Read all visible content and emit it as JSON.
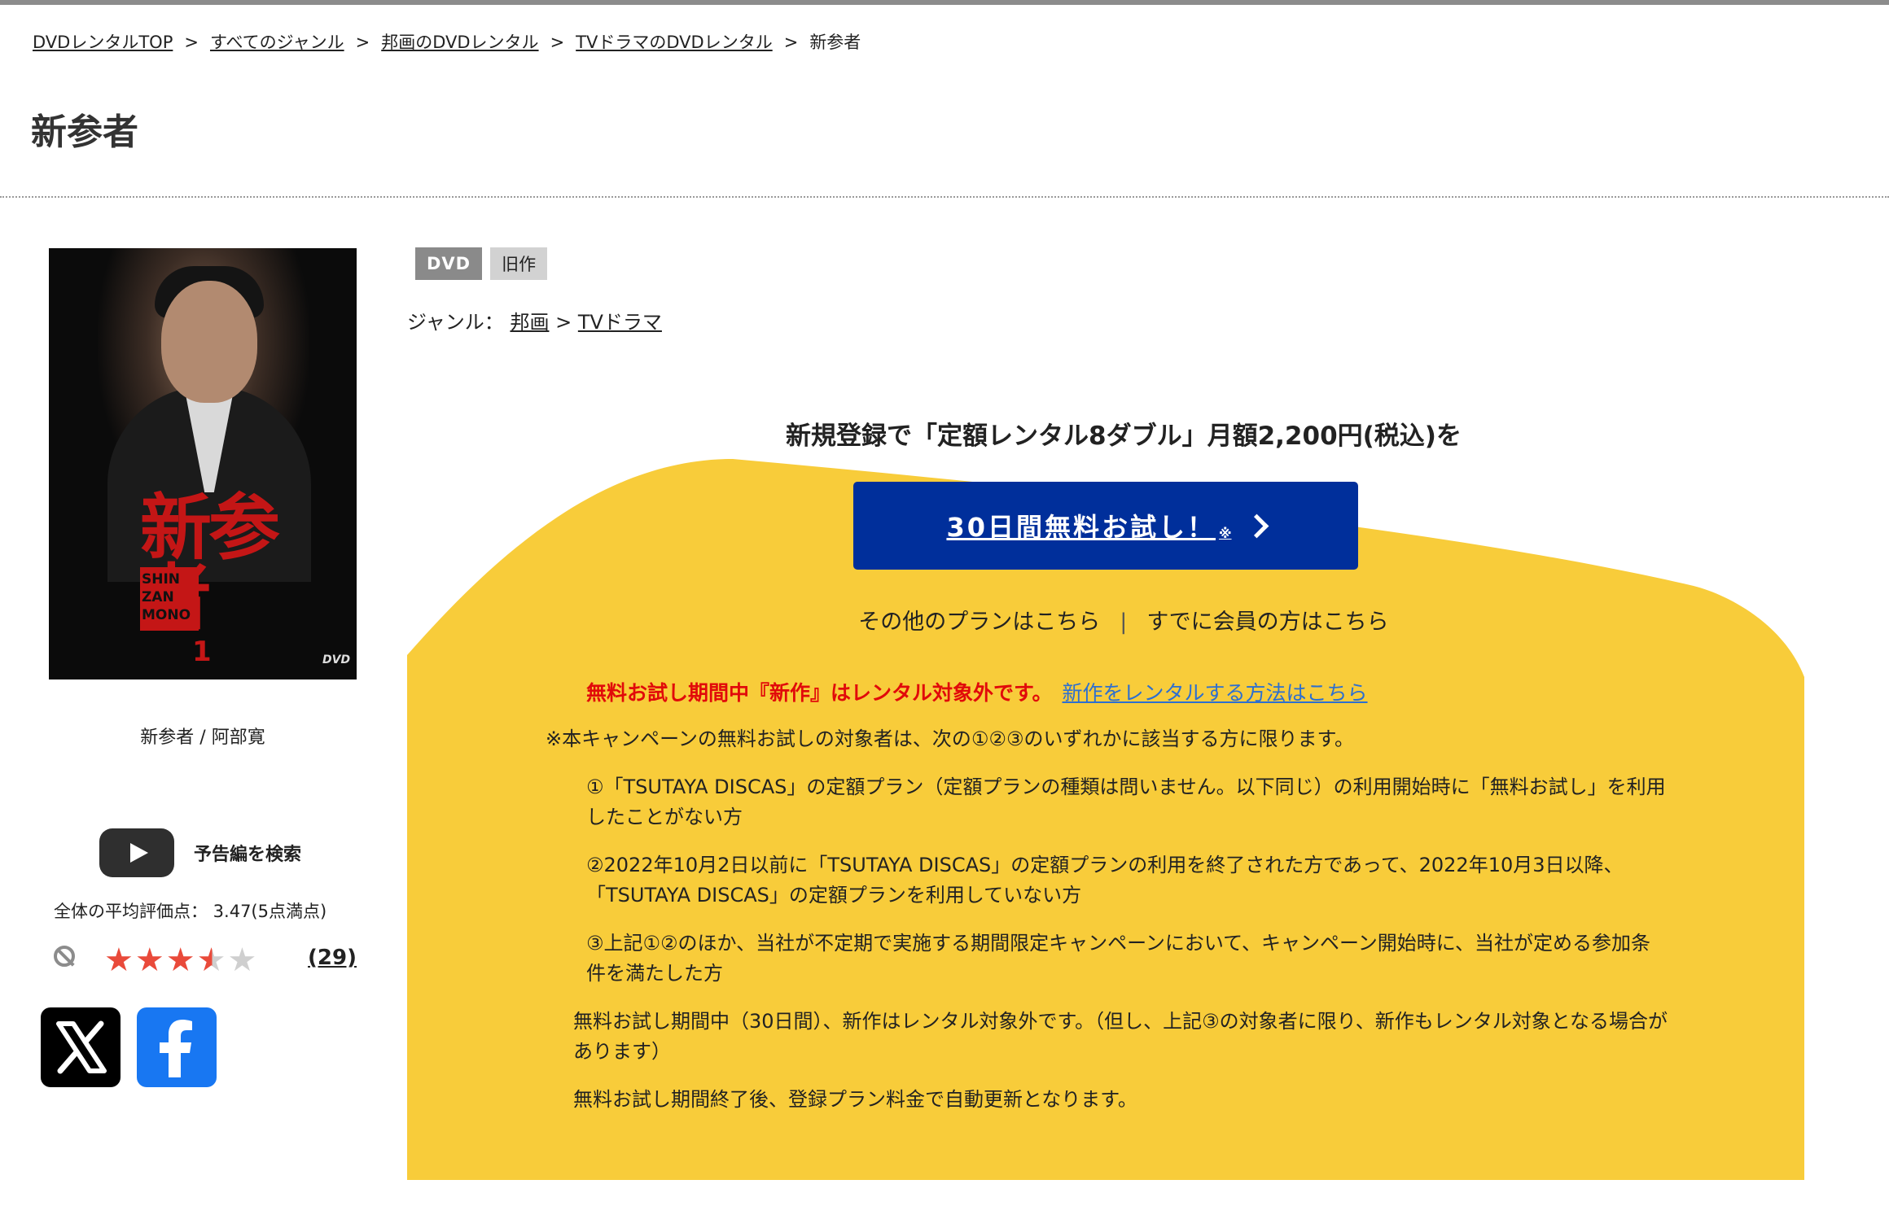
{
  "breadcrumb": {
    "items": [
      "DVDレンタルTOP",
      "すべてのジャンル",
      "邦画のDVDレンタル",
      "TVドラマのDVDレンタル"
    ],
    "current": "新参者",
    "separator": ">"
  },
  "page": {
    "title": "新参者"
  },
  "cover": {
    "title": "新参者",
    "subtitle_lines": [
      "SHIN",
      "ZAN",
      "MONO"
    ],
    "volume": "1",
    "dvd_mark": "DVD"
  },
  "item": {
    "caption": "新参者 / 阿部寛"
  },
  "trailer": {
    "label": "予告編を検索"
  },
  "rating": {
    "average_text": "全体の平均評価点： 3.47(5点満点)",
    "value": 3.47,
    "max": 5,
    "count": "(29)"
  },
  "tags": {
    "format": "DVD",
    "status": "旧作"
  },
  "genre": {
    "label": "ジャンル：",
    "parent": "邦画",
    "separator": ">",
    "child": "TVドラマ"
  },
  "promo": {
    "headline": "新規登録で「定額レンタル8ダブル」月額2,200円(税込)を",
    "cta_label": "30日間無料お試し！",
    "cta_note": "※",
    "other_plans": "その他のプランはこちら",
    "divider": "|",
    "members": "すでに会員の方はこちら",
    "warning": "無料お試し期間中『新作』はレンタル対象外です。",
    "warning_link": "新作をレンタルする方法はこちら",
    "bg_color": "#f8cc3a",
    "cta_color": "#002f9b"
  },
  "notes": {
    "intro": "※本キャンペーンの無料お試しの対象者は、次の①②③のいずれかに該当する方に限ります。",
    "item1": "①「TSUTAYA DISCAS」の定額プラン（定額プランの種類は問いません。以下同じ）の利用開始時に「無料お試し」を利用したことがない方",
    "item2": "②2022年10月2日以前に「TSUTAYA DISCAS」の定額プランの利用を終了された方であって、2022年10月3日以降、「TSUTAYA DISCAS」の定額プランを利用していない方",
    "item3": "③上記①②のほか、当社が不定期で実施する期間限定キャンペーンにおいて、キャンペーン開始時に、当社が定める参加条件を満たした方",
    "text1": "無料お試し期間中（30日間）、新作はレンタル対象外です。（但し、上記③の対象者に限り、新作もレンタル対象となる場合があります）",
    "text2": "無料お試し期間終了後、登録プラン料金で自動更新となります。"
  }
}
